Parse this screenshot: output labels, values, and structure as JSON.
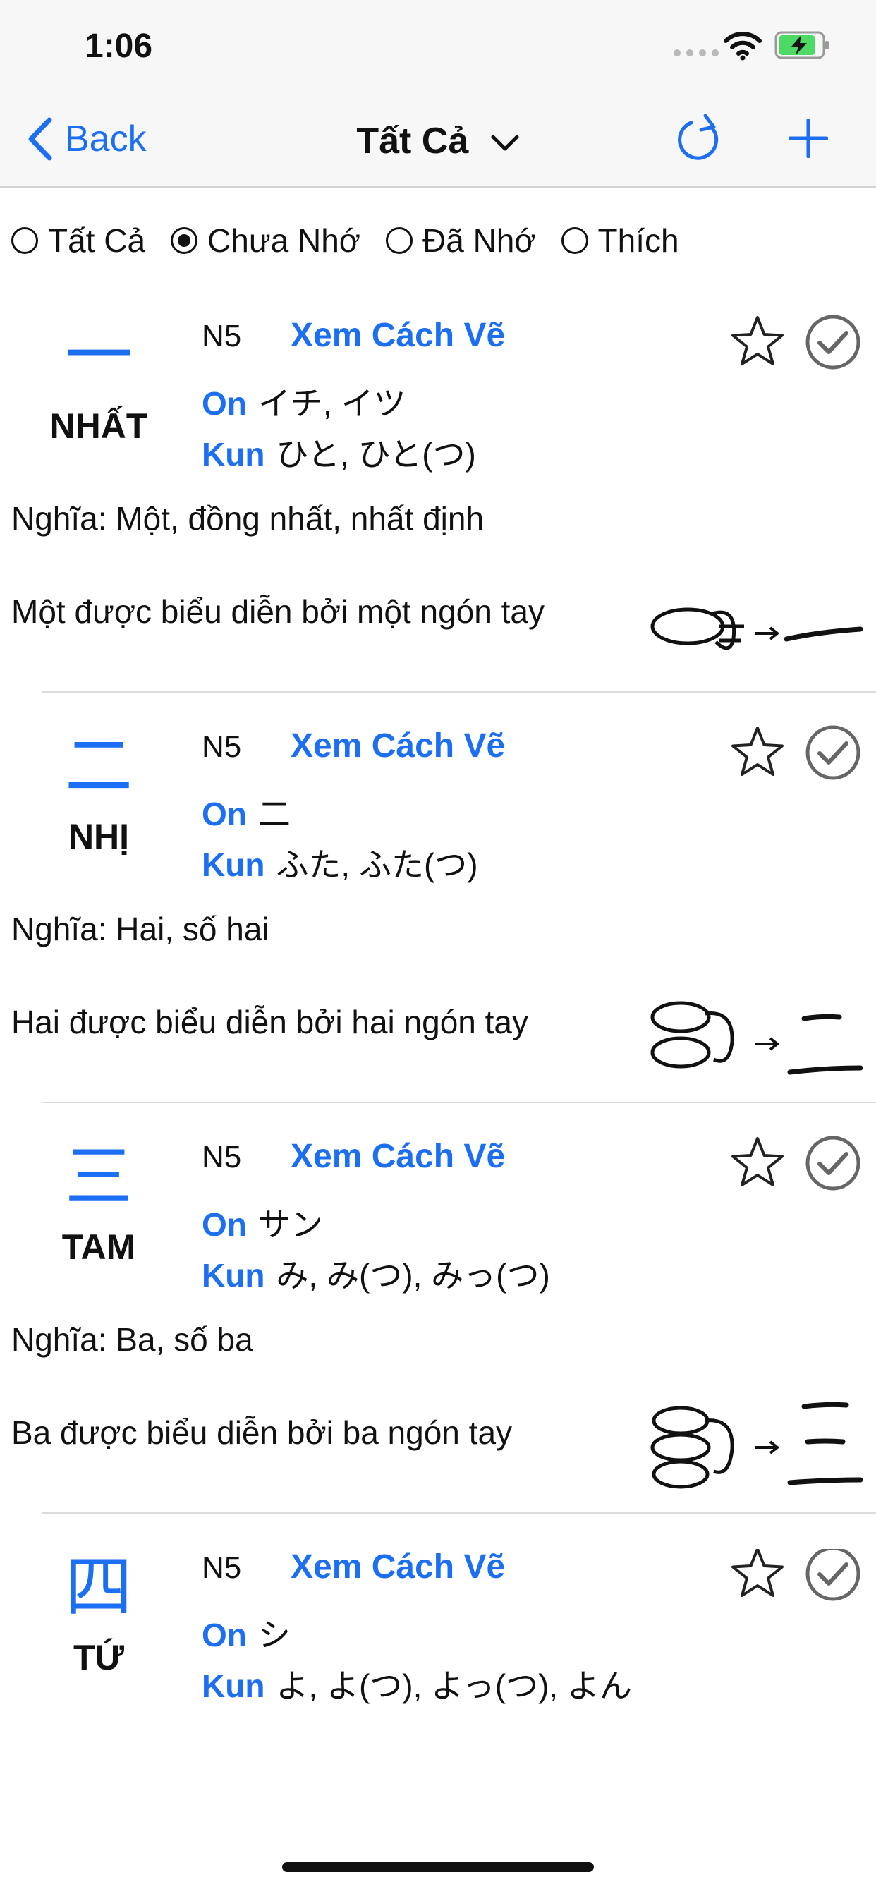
{
  "status": {
    "time": "1:06"
  },
  "nav": {
    "back_label": "Back",
    "title": "Tất Cả"
  },
  "filters": [
    {
      "label": "Tất Cả",
      "checked": false
    },
    {
      "label": "Chưa Nhớ",
      "checked": true
    },
    {
      "label": "Đã Nhớ",
      "checked": false
    },
    {
      "label": "Thích",
      "checked": false
    }
  ],
  "labels": {
    "on": "On",
    "kun": "Kun",
    "stroke": "Xem Cách Vẽ"
  },
  "cards": [
    {
      "kanji": "一",
      "hanviet": "NHẤT",
      "level": "N5",
      "on": "イチ, イツ",
      "kun": "ひと, ひと(つ)",
      "meaning": "Nghĩa: Một, đồng nhất, nhất định",
      "mnemonic": "Một được biểu diễn bởi một ngón tay"
    },
    {
      "kanji": "二",
      "hanviet": "NHỊ",
      "level": "N5",
      "on": "二",
      "kun": "ふた, ふた(つ)",
      "meaning": "Nghĩa: Hai, số hai",
      "mnemonic": "Hai được biểu diễn bởi hai ngón tay"
    },
    {
      "kanji": "三",
      "hanviet": "TAM",
      "level": "N5",
      "on": "サン",
      "kun": "み, み(つ), みっ(つ)",
      "meaning": "Nghĩa: Ba, số ba",
      "mnemonic": "Ba được biểu diễn bởi ba ngón tay"
    },
    {
      "kanji": "四",
      "hanviet": "TỨ",
      "level": "N5",
      "on": "シ",
      "kun": "よ, よ(つ), よっ(つ), よん"
    }
  ]
}
